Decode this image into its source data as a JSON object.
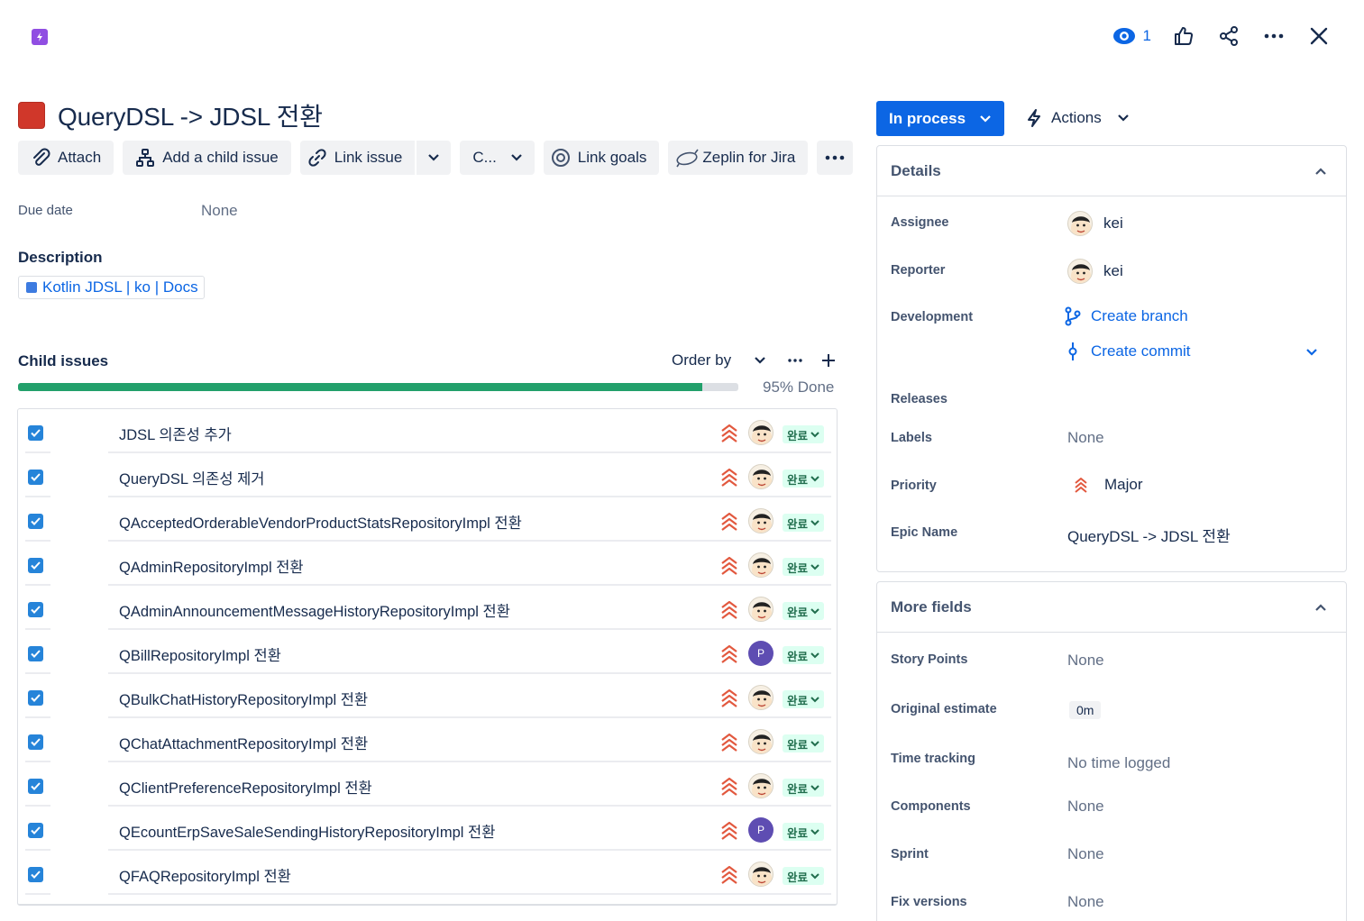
{
  "header": {
    "watch_count": "1"
  },
  "issue": {
    "title": "QueryDSL -> JDSL 전환"
  },
  "toolbar": {
    "attach": "Attach",
    "add_child": "Add a child issue",
    "link_issue": "Link issue",
    "c_menu": "C...",
    "link_goals": "Link goals",
    "zeplin": "Zeplin for Jira"
  },
  "due": {
    "label": "Due date",
    "value": "None"
  },
  "description": {
    "heading": "Description",
    "link_text": "Kotlin JDSL | ko | Docs"
  },
  "child_issues": {
    "heading": "Child issues",
    "order_by": "Order by",
    "progress_percent": 95,
    "progress_label": "95% Done",
    "items": [
      {
        "summary": "JDSL 의존성 추가",
        "avatar": "kei",
        "status": "완료"
      },
      {
        "summary": "QueryDSL 의존성 제거",
        "avatar": "kei",
        "status": "완료"
      },
      {
        "summary": "QAcceptedOrderableVendorProductStatsRepositoryImpl 전환",
        "avatar": "kei",
        "status": "완료"
      },
      {
        "summary": "QAdminRepositoryImpl 전환",
        "avatar": "kei",
        "status": "완료"
      },
      {
        "summary": "QAdminAnnouncementMessageHistoryRepositoryImpl 전환",
        "avatar": "kei",
        "status": "완료"
      },
      {
        "summary": "QBillRepositoryImpl 전환",
        "avatar": "P",
        "status": "완료"
      },
      {
        "summary": "QBulkChatHistoryRepositoryImpl 전환",
        "avatar": "kei",
        "status": "완료"
      },
      {
        "summary": "QChatAttachmentRepositoryImpl 전환",
        "avatar": "kei",
        "status": "완료"
      },
      {
        "summary": "QClientPreferenceRepositoryImpl 전환",
        "avatar": "kei",
        "status": "완료"
      },
      {
        "summary": "QEcountErpSaveSaleSendingHistoryRepositoryImpl 전환",
        "avatar": "P",
        "status": "완료"
      },
      {
        "summary": "QFAQRepositoryImpl 전환",
        "avatar": "kei",
        "status": "완료"
      }
    ]
  },
  "sidebar": {
    "status_button": "In process",
    "actions": "Actions",
    "details": {
      "heading": "Details",
      "assignee_label": "Assignee",
      "assignee": "kei",
      "reporter_label": "Reporter",
      "reporter": "kei",
      "development_label": "Development",
      "create_branch": "Create branch",
      "create_commit": "Create commit",
      "releases_label": "Releases",
      "labels_label": "Labels",
      "labels": "None",
      "priority_label": "Priority",
      "priority": "Major",
      "epic_name_label": "Epic Name",
      "epic_name": "QueryDSL -> JDSL 전환"
    },
    "more_fields": {
      "heading": "More fields",
      "story_points_label": "Story Points",
      "story_points": "None",
      "original_estimate_label": "Original estimate",
      "original_estimate": "0m",
      "time_tracking_label": "Time tracking",
      "time_tracking": "No time logged",
      "components_label": "Components",
      "components": "None",
      "sprint_label": "Sprint",
      "sprint": "None",
      "fix_versions_label": "Fix versions",
      "fix_versions": "None"
    }
  },
  "colors": {
    "primary": "#0c66e4",
    "epic": "#904ee2",
    "issue_type": "#d0372a",
    "progress": "#22a06b",
    "done_badge_bg": "#dcfff1",
    "done_badge_text": "#216e4e",
    "priority_major": "#e2583e"
  }
}
